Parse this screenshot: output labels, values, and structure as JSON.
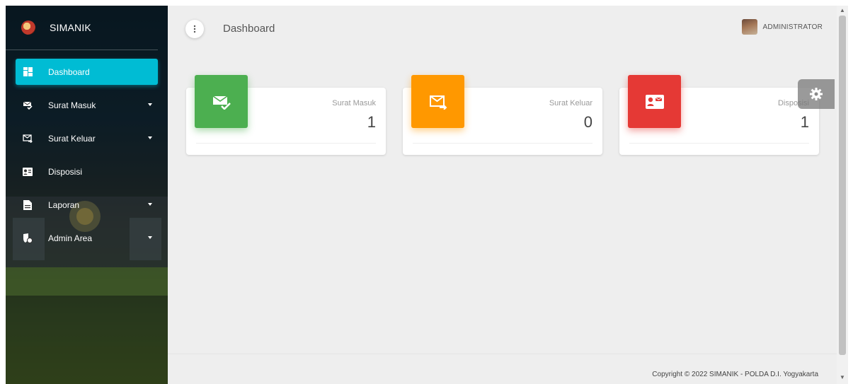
{
  "brand": {
    "name": "SIMANIK"
  },
  "sidebar": {
    "items": [
      {
        "label": "Dashboard",
        "icon": "dashboard-icon",
        "active": true,
        "has_caret": false
      },
      {
        "label": "Surat Masuk",
        "icon": "mail-check-icon",
        "active": false,
        "has_caret": true
      },
      {
        "label": "Surat Keluar",
        "icon": "mail-send-icon",
        "active": false,
        "has_caret": true
      },
      {
        "label": "Disposisi",
        "icon": "contact-card-icon",
        "active": false,
        "has_caret": false
      },
      {
        "label": "Laporan",
        "icon": "document-icon",
        "active": false,
        "has_caret": true
      },
      {
        "label": "Admin Area",
        "icon": "admin-shield-icon",
        "active": false,
        "has_caret": true
      }
    ]
  },
  "header": {
    "title": "Dashboard",
    "user_name": "ADMINISTRATOR"
  },
  "cards": [
    {
      "label": "Surat Masuk",
      "value": "1",
      "color": "#4caf50",
      "icon": "mail-check-icon"
    },
    {
      "label": "Surat Keluar",
      "value": "0",
      "color": "#ff9800",
      "icon": "mail-send-icon"
    },
    {
      "label": "Disposisi",
      "value": "1",
      "color": "#e53935",
      "icon": "contact-card-icon"
    }
  ],
  "footer": {
    "copyright": "Copyright © 2022 SIMANIK - POLDA D.I. Yogyakarta"
  },
  "colors": {
    "accent": "#00bcd4",
    "background": "#eeeeee"
  }
}
